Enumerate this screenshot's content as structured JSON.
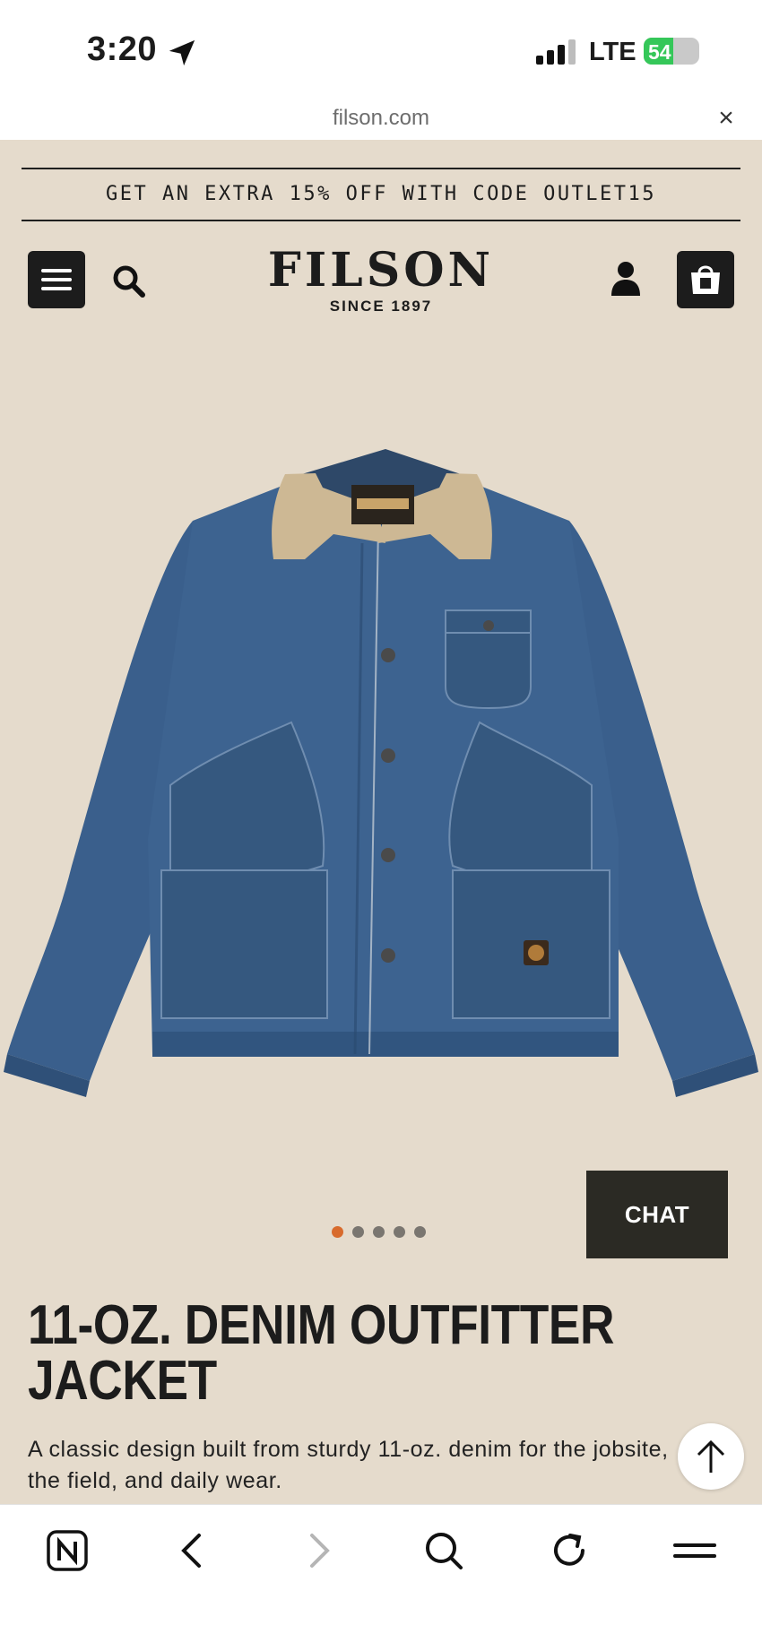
{
  "status_bar": {
    "time": "3:20",
    "network": "LTE",
    "battery_level": 54,
    "battery_text": "54"
  },
  "browser": {
    "domain": "filson.com"
  },
  "promo": {
    "text": "GET AN EXTRA 15% OFF WITH CODE OUTLET15"
  },
  "header": {
    "brand": "FILSON",
    "since": "SINCE 1897"
  },
  "product": {
    "image_icon": "denim-jacket-image",
    "carousel_total": 5,
    "carousel_active": 1,
    "title": "11-OZ. DENIM OUTFITTER JACKET",
    "description": "A classic design built from sturdy 11-oz. denim for the jobsite, the field, and daily wear."
  },
  "chat": {
    "label": "CHAT"
  },
  "colors": {
    "page_background": "#e5dbcc",
    "active_dot": "#d86b2d",
    "chat_background": "#2b2a24",
    "denim": "#3a5f8c",
    "collar": "#cdb894"
  },
  "toolbar": {
    "icons": [
      "notion-icon",
      "back-icon",
      "forward-icon",
      "search-icon",
      "reload-icon",
      "menu-icon"
    ]
  }
}
